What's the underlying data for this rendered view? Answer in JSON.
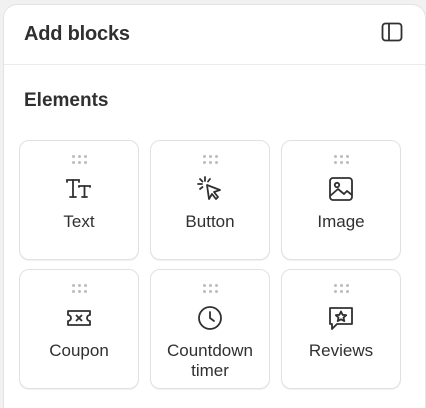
{
  "panel": {
    "title": "Add blocks",
    "toggle_icon": "sidebar-layout-icon"
  },
  "section": {
    "title": "Elements"
  },
  "blocks": [
    {
      "label": "Text",
      "icon": "text-type-icon"
    },
    {
      "label": "Button",
      "icon": "cursor-click-icon"
    },
    {
      "label": "Image",
      "icon": "image-icon"
    },
    {
      "label": "Coupon",
      "icon": "ticket-icon"
    },
    {
      "label": "Countdown timer",
      "icon": "clock-icon"
    },
    {
      "label": "Reviews",
      "icon": "star-chat-icon"
    }
  ],
  "colors": {
    "text": "#303030",
    "border": "#e1e1e1",
    "handle": "#bdbdbd"
  }
}
